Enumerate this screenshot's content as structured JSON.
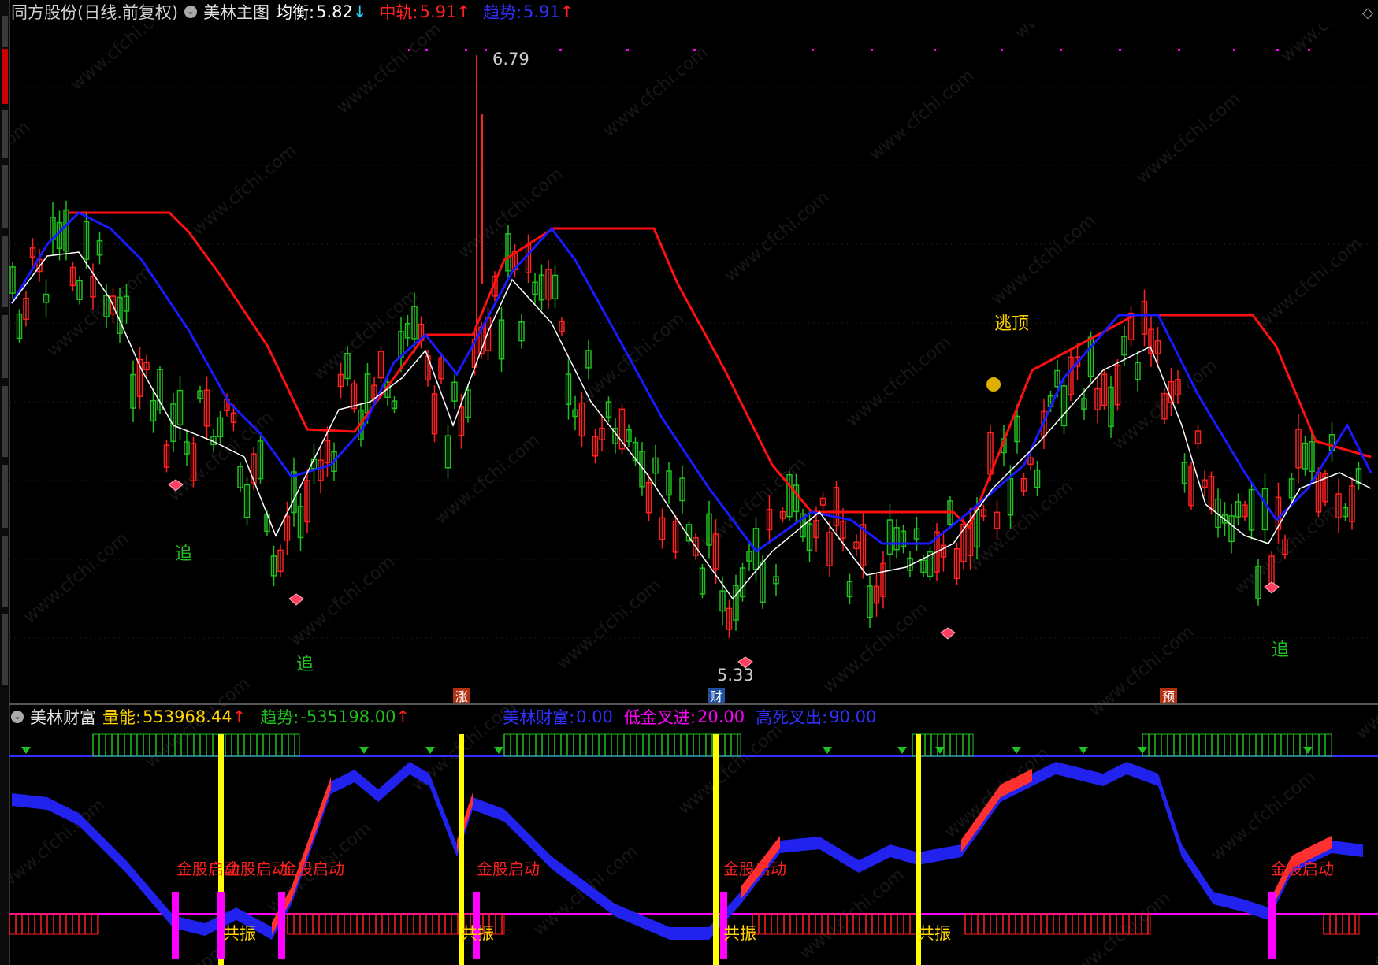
{
  "main_header": {
    "title": "同方股份(日线.前复权)",
    "indicator_name": "美林主图",
    "balance_label": "均衡:",
    "balance_value": "5.82",
    "balance_arrow": "↓",
    "mid_label": "中轨:",
    "mid_value": "5.91",
    "mid_arrow": "↑",
    "trend_label": "趋势:",
    "trend_value": "5.91",
    "trend_arrow": "↑"
  },
  "sub_header": {
    "indicator_name": "美林财富",
    "volume_label": "量能:",
    "volume_value": "553968.44",
    "volume_arrow": "↑",
    "trend_label": "趋势:",
    "trend_value": "-535198.00",
    "trend_arrow": "↑",
    "wealth_label": "美林财富:",
    "wealth_value": "0.00",
    "low_gold_label": "低金叉进:",
    "low_gold_value": "20.00",
    "high_death_label": "高死叉出:",
    "high_death_value": "90.00"
  },
  "price_labels": {
    "high": "6.79",
    "low": "5.33"
  },
  "chart_annotations": {
    "chase": "追",
    "escape_top": "逃顶",
    "gold_start": "金股启动",
    "resonance": "共振",
    "tags": [
      "涨",
      "财",
      "预"
    ]
  },
  "watermark": "www.cfchi.com",
  "colors": {
    "background": "#000000",
    "up_candle": "#ff2020",
    "down_candle": "#20c020",
    "mid_band": "#ff1010",
    "trend_line": "#1a1aff",
    "balance_line": "#ffffff",
    "yellow_bar": "#ffff00",
    "magenta_bar": "#ff00ff",
    "red_fill": "#ff3030",
    "blue_fill": "#2222ee"
  },
  "icons": {
    "collapse": "circle-chevron-icon",
    "diamond": "diamond-icon",
    "money_bag": "money-bag-icon",
    "down_arrow": "green-down-arrow-icon"
  },
  "chart_data": {
    "type": "candlestick",
    "price_range": [
      5.2,
      6.85
    ],
    "high_marker": 6.79,
    "low_marker": 5.33,
    "series": [
      {
        "name": "均衡",
        "last": 5.82
      },
      {
        "name": "中轨",
        "last": 5.91
      },
      {
        "name": "趋势",
        "last": 5.91
      }
    ]
  }
}
